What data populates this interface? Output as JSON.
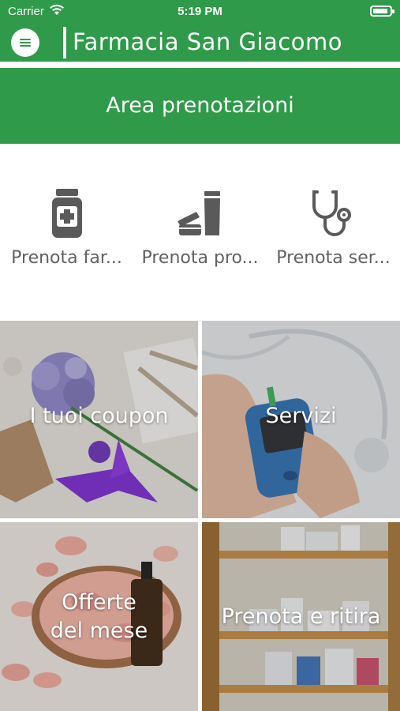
{
  "status_bar": {
    "carrier": "Carrier",
    "time": "5:19 PM"
  },
  "navbar": {
    "title": "Farmacia San Giacomo"
  },
  "banner": {
    "title": "Area prenotazioni"
  },
  "quick_actions": [
    {
      "label": "Prenota far...",
      "icon": "medicine-bottle-icon"
    },
    {
      "label": "Prenota pro...",
      "icon": "cosmetics-icon"
    },
    {
      "label": "Prenota ser...",
      "icon": "stethoscope-icon"
    }
  ],
  "tiles": [
    {
      "label": "I tuoi coupon"
    },
    {
      "label": "Servizi"
    },
    {
      "label_line1": "Offerte",
      "label_line2": "del mese"
    },
    {
      "label": "Prenota e ritira"
    }
  ],
  "colors": {
    "brand_green": "#2f9a49",
    "icon_gray": "#5a5a5a"
  }
}
